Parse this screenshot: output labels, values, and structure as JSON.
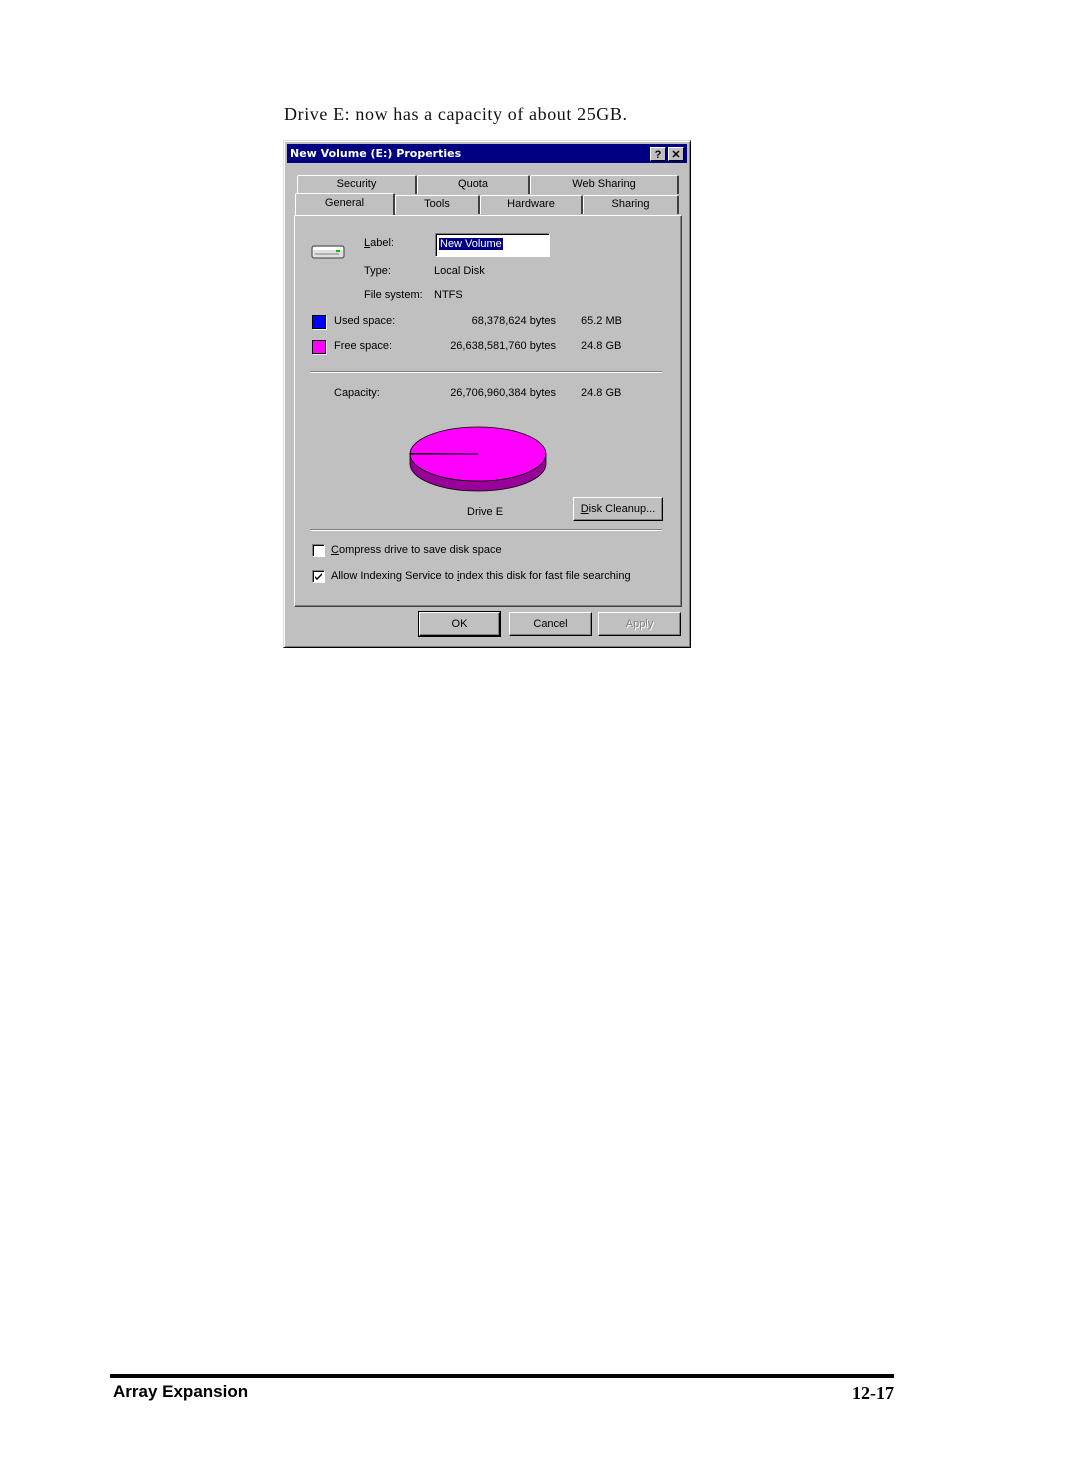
{
  "caption": "Drive E: now has a capacity of about 25GB.",
  "dialog": {
    "title": "New Volume (E:) Properties",
    "help_button": "?",
    "close_button": "✕",
    "tabs_back": [
      "Security",
      "Quota",
      "Web Sharing"
    ],
    "tabs_front": [
      "General",
      "Tools",
      "Hardware",
      "Sharing"
    ],
    "active_tab": "General",
    "drive_icon": "hard-drive-icon",
    "label_caption": "Label:",
    "label_value": "New Volume",
    "type_caption": "Type:",
    "type_value": "Local Disk",
    "fs_caption": "File system:",
    "fs_value": "NTFS",
    "used": {
      "label": "Used space:",
      "bytes": "68,378,624 bytes",
      "size": "65.2 MB",
      "color": "#0000ff"
    },
    "free": {
      "label": "Free space:",
      "bytes": "26,638,581,760 bytes",
      "size": "24.8 GB",
      "color": "#ff00ff"
    },
    "capacity": {
      "label": "Capacity:",
      "bytes": "26,706,960,384 bytes",
      "size": "24.8 GB"
    },
    "pie_caption": "Drive E",
    "pie_used_fraction": 0.0026,
    "disk_cleanup_button": "Disk Cleanup...",
    "compress_checkbox": {
      "label": "Compress drive to save disk space",
      "checked": false
    },
    "index_checkbox": {
      "label": "Allow Indexing Service to index this disk for fast file searching",
      "checked": true
    },
    "ok_button": "OK",
    "cancel_button": "Cancel",
    "apply_button": "Apply",
    "apply_enabled": false
  },
  "footer": {
    "section": "Array Expansion",
    "page": "12-17"
  }
}
